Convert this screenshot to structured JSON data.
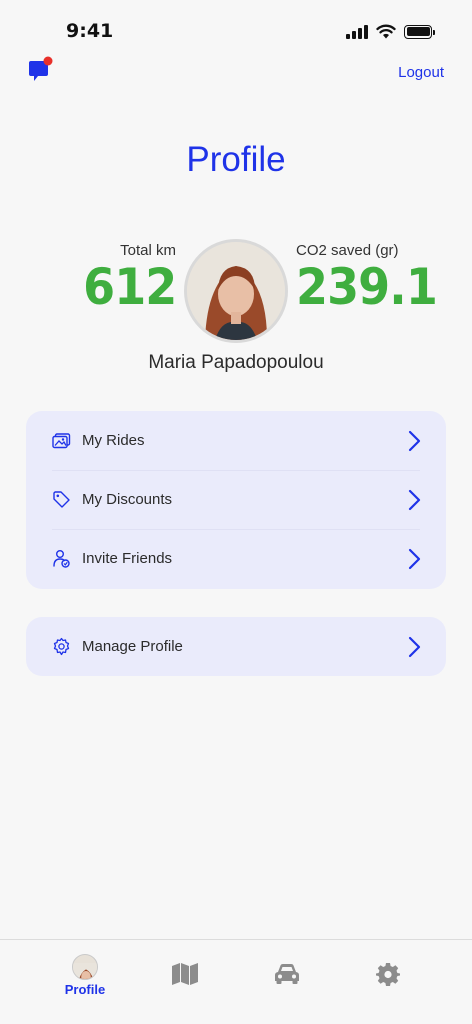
{
  "status_bar": {
    "time": "9:41"
  },
  "header": {
    "logout_label": "Logout"
  },
  "page": {
    "title": "Profile"
  },
  "stats": {
    "total_km_label": "Total km",
    "total_km_value": "612",
    "co2_label": "CO2 saved (gr)",
    "co2_value": "239.1"
  },
  "user": {
    "name": "Maria Papadopoulou"
  },
  "menu": {
    "items": [
      {
        "label": "My Rides",
        "icon": "rides-icon"
      },
      {
        "label": "My Discounts",
        "icon": "tag-icon"
      },
      {
        "label": "Invite Friends",
        "icon": "invite-icon"
      }
    ],
    "manage": {
      "label": "Manage Profile",
      "icon": "gear-icon"
    }
  },
  "tab_bar": {
    "tabs": [
      {
        "label": "Profile",
        "icon": "avatar",
        "active": true
      },
      {
        "label": "",
        "icon": "map-icon"
      },
      {
        "label": "",
        "icon": "car-icon"
      },
      {
        "label": "",
        "icon": "gear-icon"
      }
    ]
  },
  "colors": {
    "accent": "#1f33e8",
    "stat_green": "#3fae3f",
    "card_bg": "#eaebfb",
    "notification_dot": "#e8302a",
    "inactive_icon": "#8c8c8c"
  }
}
